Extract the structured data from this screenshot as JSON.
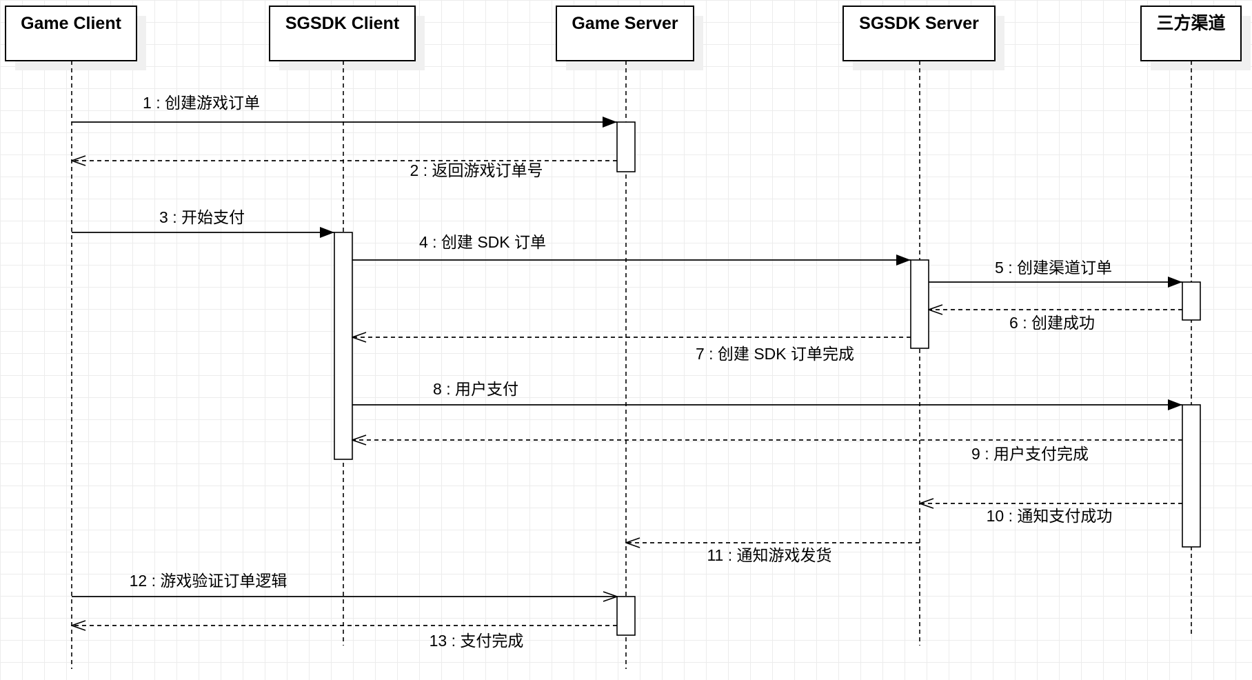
{
  "diagram_type": "sequence",
  "participants": [
    {
      "name": "Game Client"
    },
    {
      "name": "SGSDK Client"
    },
    {
      "name": "Game Server"
    },
    {
      "name": "SGSDK Server"
    },
    {
      "name": "三方渠道"
    }
  ],
  "messages": [
    {
      "from": 0,
      "to": 2,
      "label": "1 : 创建游戏订单",
      "kind": "sync"
    },
    {
      "from": 2,
      "to": 0,
      "label": "2 : 返回游戏订单号",
      "kind": "return"
    },
    {
      "from": 0,
      "to": 1,
      "label": "3 : 开始支付",
      "kind": "sync"
    },
    {
      "from": 1,
      "to": 3,
      "label": "4 : 创建 SDK 订单",
      "kind": "sync"
    },
    {
      "from": 3,
      "to": 4,
      "label": "5 : 创建渠道订单",
      "kind": "sync"
    },
    {
      "from": 4,
      "to": 3,
      "label": "6 : 创建成功",
      "kind": "return"
    },
    {
      "from": 3,
      "to": 1,
      "label": "7 : 创建 SDK 订单完成",
      "kind": "return"
    },
    {
      "from": 1,
      "to": 4,
      "label": "8 : 用户支付",
      "kind": "sync"
    },
    {
      "from": 4,
      "to": 1,
      "label": "9 : 用户支付完成",
      "kind": "return"
    },
    {
      "from": 4,
      "to": 3,
      "label": "10 : 通知支付成功",
      "kind": "return"
    },
    {
      "from": 3,
      "to": 2,
      "label": "11 : 通知游戏发货",
      "kind": "return"
    },
    {
      "from": 0,
      "to": 2,
      "label": "12 : 游戏验证订单逻辑",
      "kind": "async"
    },
    {
      "from": 2,
      "to": 0,
      "label": "13 : 支付完成",
      "kind": "return"
    }
  ]
}
